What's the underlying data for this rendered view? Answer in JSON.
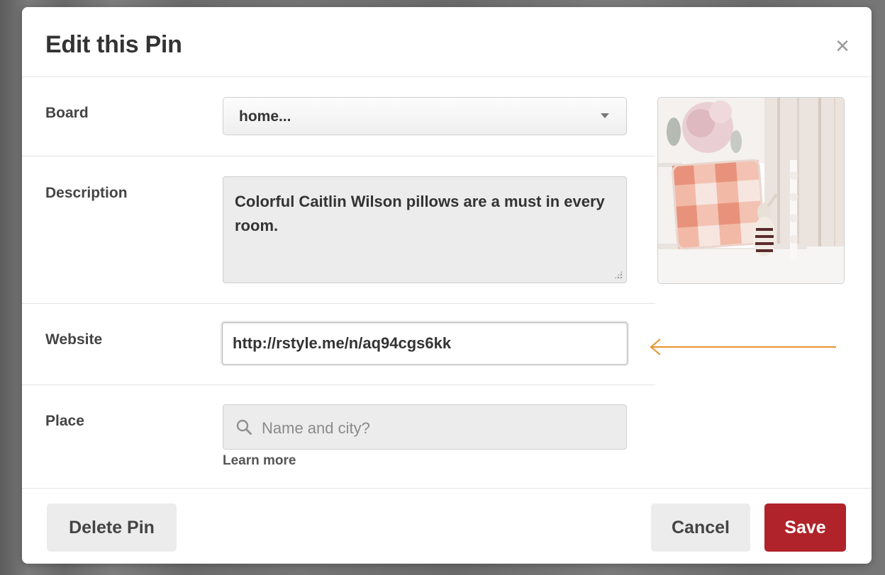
{
  "dialog": {
    "title": "Edit this Pin",
    "close_symbol": "×"
  },
  "fields": {
    "board": {
      "label": "Board",
      "value": "home..."
    },
    "description": {
      "label": "Description",
      "value": "Colorful Caitlin Wilson pillows are a must in every room."
    },
    "website": {
      "label": "Website",
      "value": "http://rstyle.me/n/aq94cgs6kk"
    },
    "place": {
      "label": "Place",
      "placeholder": "Name and city?",
      "learn_more": "Learn more"
    }
  },
  "footer": {
    "delete_label": "Delete Pin",
    "cancel_label": "Cancel",
    "save_label": "Save"
  },
  "colors": {
    "save_button": "#b0232a",
    "annotation_arrow": "#e8922e",
    "secondary_button": "#ececec"
  },
  "icons": {
    "close": "close-icon",
    "search": "search-icon",
    "dropdown": "chevron-down-icon"
  }
}
